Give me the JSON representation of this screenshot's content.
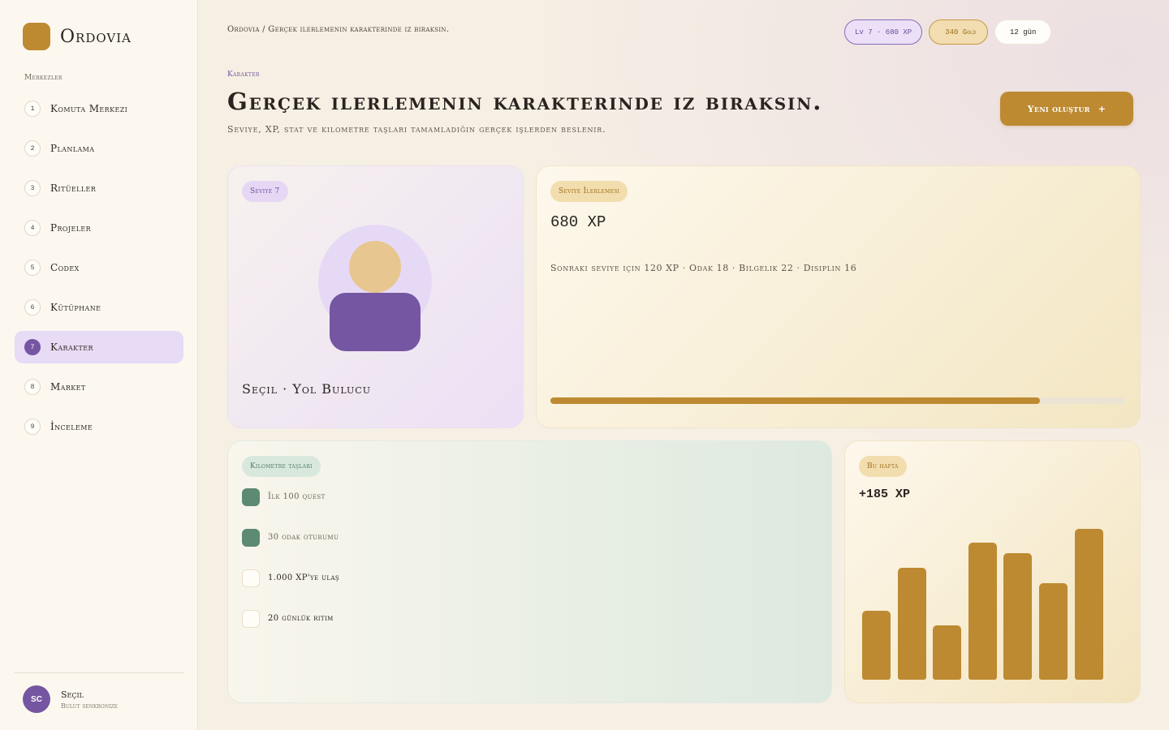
{
  "app": {
    "name": "Ordovia"
  },
  "sidebar": {
    "section_label": "Merkezler",
    "items": [
      {
        "num": "1",
        "label": "Komuta Merkezi"
      },
      {
        "num": "2",
        "label": "Planlama"
      },
      {
        "num": "3",
        "label": "Ritüeller"
      },
      {
        "num": "4",
        "label": "Projeler"
      },
      {
        "num": "5",
        "label": "Codex"
      },
      {
        "num": "6",
        "label": "Kütüphane"
      },
      {
        "num": "7",
        "label": "Karakter",
        "active": true
      },
      {
        "num": "8",
        "label": "Market"
      },
      {
        "num": "9",
        "label": "İnceleme"
      }
    ],
    "user": {
      "initials": "SC",
      "name": "Seçil",
      "status": "Bulut senkronize"
    }
  },
  "header": {
    "breadcrumb": "Ordovia / Gerçek ilerlemenin karakterinde iz bıraksın.",
    "pills": {
      "level_xp": "Lv 7 · 680 XP",
      "gold": "340 Gold",
      "days": "12 gün"
    }
  },
  "page": {
    "eyebrow": "Karakter",
    "title": "Gerçek ilerlemenin karakterinde iz bıraksın.",
    "subtitle": "Seviye, XP, stat ve kilometre taşları tamamladığın gerçek işlerden beslenir.",
    "cta_label": "Yeni oluştur",
    "cta_icon": "+"
  },
  "character_card": {
    "tag": "Seviye 7",
    "name": "Seçil · Yol Bulucu",
    "colors": {
      "halo": "#e6d9f5",
      "head": "#e8c68f",
      "body": "#7556a2"
    }
  },
  "progress_card": {
    "tag": "Seviye İlerlemesi",
    "xp": "680 XP",
    "stats": "Sonraki seviye için 120 XP · Odak 18 · Bilgelik 22 · Disiplin 16",
    "progress_fraction": 0.85
  },
  "milestones_card": {
    "tag": "Kilometre taşları",
    "items": [
      {
        "label": "İlk 100 quest",
        "done": true
      },
      {
        "label": "30 odak oturumu",
        "done": true
      },
      {
        "label": "1.000 XP'ye ulaş",
        "done": false
      },
      {
        "label": "20 günlük ritim",
        "done": false
      }
    ]
  },
  "week_card": {
    "tag": "Bu hafta",
    "xp": "+185 XP",
    "bar_values": [
      0.455,
      0.74,
      0.36,
      0.91,
      0.84,
      0.64,
      1.0
    ]
  },
  "colors": {
    "accent_gold": "#bd8a32",
    "accent_purple": "#7556a2",
    "success_green": "#5c8a72"
  }
}
